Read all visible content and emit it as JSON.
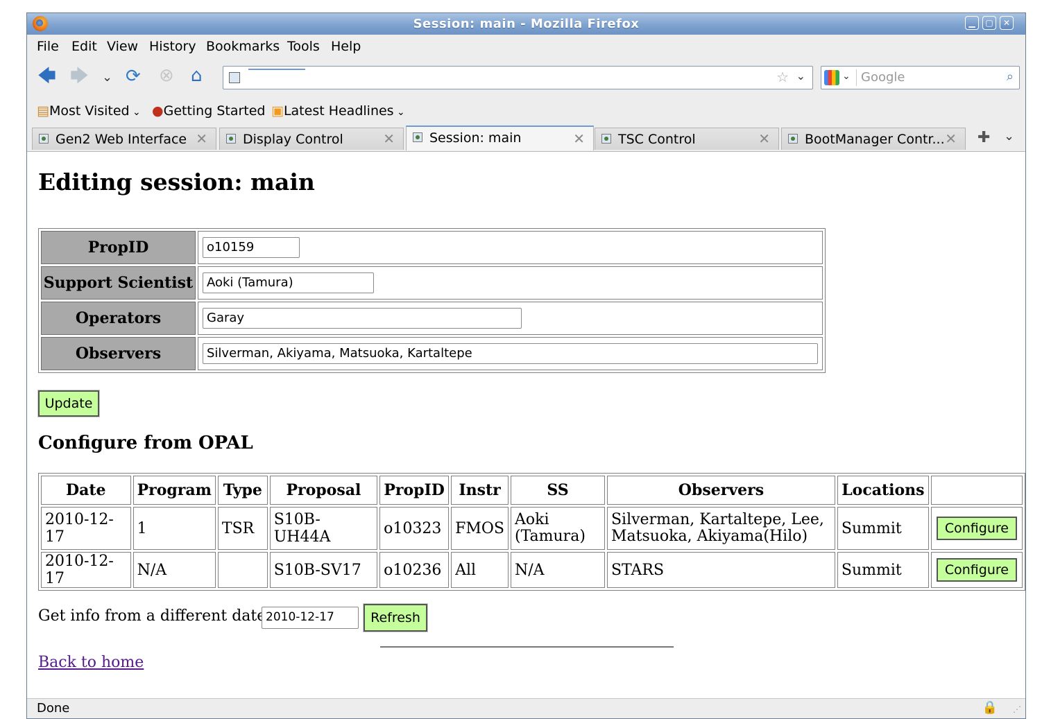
{
  "window": {
    "title": "Session: main - Mozilla Firefox"
  },
  "menu": [
    "File",
    "Edit",
    "View",
    "History",
    "Bookmarks",
    "Tools",
    "Help"
  ],
  "search": {
    "placeholder": "Google"
  },
  "bookmarks": [
    "Most Visited",
    "Getting Started",
    "Latest Headlines"
  ],
  "tabs": [
    "Gen2 Web Interface",
    "Display Control",
    "Session: main",
    "TSC Control",
    "BootManager Contr..."
  ],
  "page": {
    "heading": "Editing session: main",
    "form": {
      "propid_label": "PropID",
      "propid_value": "o10159",
      "ss_label": "Support Scientist",
      "ss_value": "Aoki (Tamura)",
      "operators_label": "Operators",
      "operators_value": "Garay",
      "observers_label": "Observers",
      "observers_value": "Silverman, Akiyama, Matsuoka, Kartaltepe"
    },
    "update_label": "Update",
    "opal_heading": "Configure from OPAL",
    "opal_columns": [
      "Date",
      "Program",
      "Type",
      "Proposal",
      "PropID",
      "Instr",
      "SS",
      "Observers",
      "Locations",
      ""
    ],
    "opal_rows": [
      {
        "date": "2010-12-17",
        "program": "1",
        "type": "TSR",
        "proposal": "S10B-UH44A",
        "propid": "o10323",
        "instr": "FMOS",
        "ss": "Aoki (Tamura)",
        "observers": "Silverman, Kartaltepe, Lee, Matsuoka, Akiyama(Hilo)",
        "locations": "Summit",
        "action": "Configure"
      },
      {
        "date": "2010-12-17",
        "program": "N/A",
        "type": "",
        "proposal": "S10B-SV17",
        "propid": "o10236",
        "instr": "All",
        "ss": "N/A",
        "observers": "STARS",
        "locations": "Summit",
        "action": "Configure"
      }
    ],
    "date_prompt": "Get info from a different date",
    "date_value": "2010-12-17",
    "refresh_label": "Refresh",
    "back_link": "Back to home"
  },
  "status": {
    "text": "Done"
  }
}
